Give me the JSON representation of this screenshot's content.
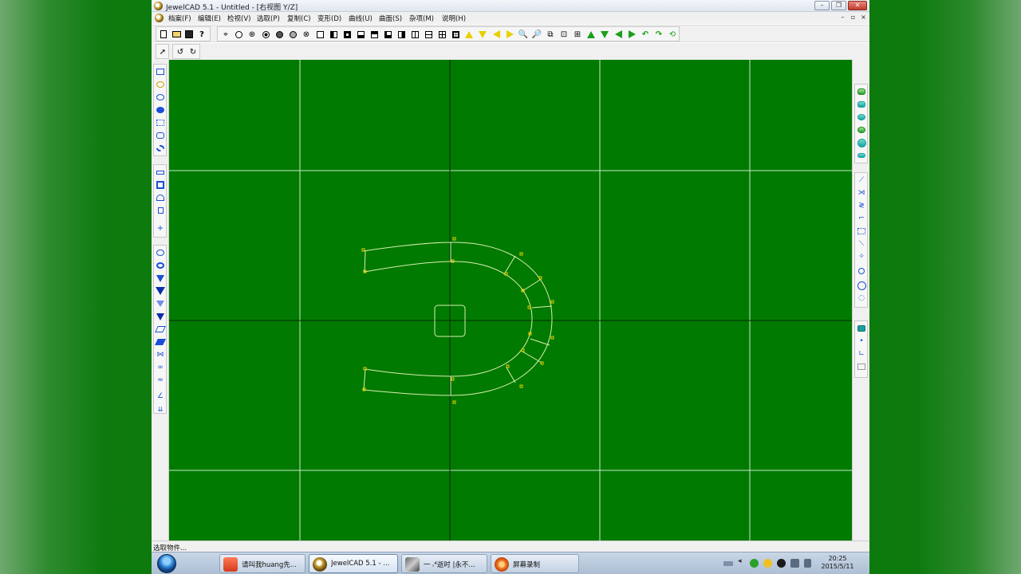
{
  "window": {
    "title": "JewelCAD 5.1 - Untitled - [右视图 Y/Z]",
    "minimize_glyph": "–",
    "restore_glyph": "❐",
    "close_glyph": "✕"
  },
  "menubar": {
    "items": [
      "档案(F)",
      "编辑(E)",
      "检视(V)",
      "选取(P)",
      "复制(C)",
      "变形(D)",
      "曲线(U)",
      "曲面(S)",
      "杂项(M)",
      "说明(H)"
    ],
    "mdi_minimize": "–",
    "mdi_restore": "▫",
    "mdi_close": "×"
  },
  "statusbar": {
    "text": "选取物件..."
  },
  "colors": {
    "viewport_bg": "#007a00",
    "grid_line": "#c8e8c8",
    "axis_line": "#0a2a0a",
    "curve": "#d8f0b0",
    "control_point": "#e8d000"
  },
  "taskbar": {
    "buttons": [
      {
        "label": "请叫我huang先...",
        "icon": "red-app-icon"
      },
      {
        "label": "JewelCAD 5.1 - ...",
        "icon": "jewelcad-icon"
      },
      {
        "label": "一 ᵣ⁴逝时 |永不...",
        "icon": "photo-avatar-icon"
      },
      {
        "label": "屏幕录制",
        "icon": "screen-record-icon"
      }
    ],
    "clock": {
      "time": "20:25",
      "date": "2015/5/11"
    }
  }
}
